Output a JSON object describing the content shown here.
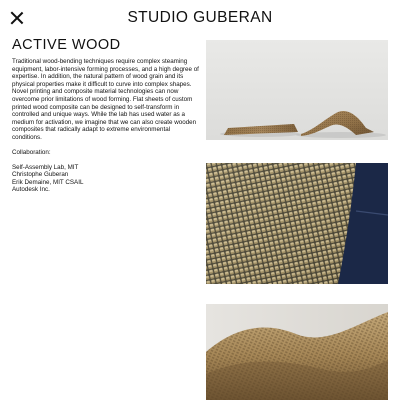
{
  "header": {
    "brand": "STUDIO GUBERAN",
    "close_icon": "close-icon"
  },
  "project": {
    "title": "ACTIVE WOOD",
    "description": "Traditional wood-bending techniques require complex steaming equipment, labor-intensive forming processes,  and a high degree of expertise. In addition, the natural pattern of wood grain and its physical properties make it difficult to curve into complex shapes. Novel printing and composite material technologies can now overcome prior limitations of wood forming. Flat sheets of custom printed wood composite can be designed to self-transform in controlled and unique ways. While the lab has used water as a medium for activation, we imagine that we can also create wooden composites that radically adapt to extreme environmental conditions.",
    "collaboration_heading": "Collaboration:",
    "collaborators": [
      "Self-Assembly Lab, MIT",
      "Christophe Guberan",
      "Erik Demaine, MIT CSAIL",
      "Autodesk Inc."
    ]
  },
  "colors": {
    "text": "#111111",
    "background": "#ffffff",
    "wood": "#a98a5e",
    "navy": "#1e2b4a"
  }
}
